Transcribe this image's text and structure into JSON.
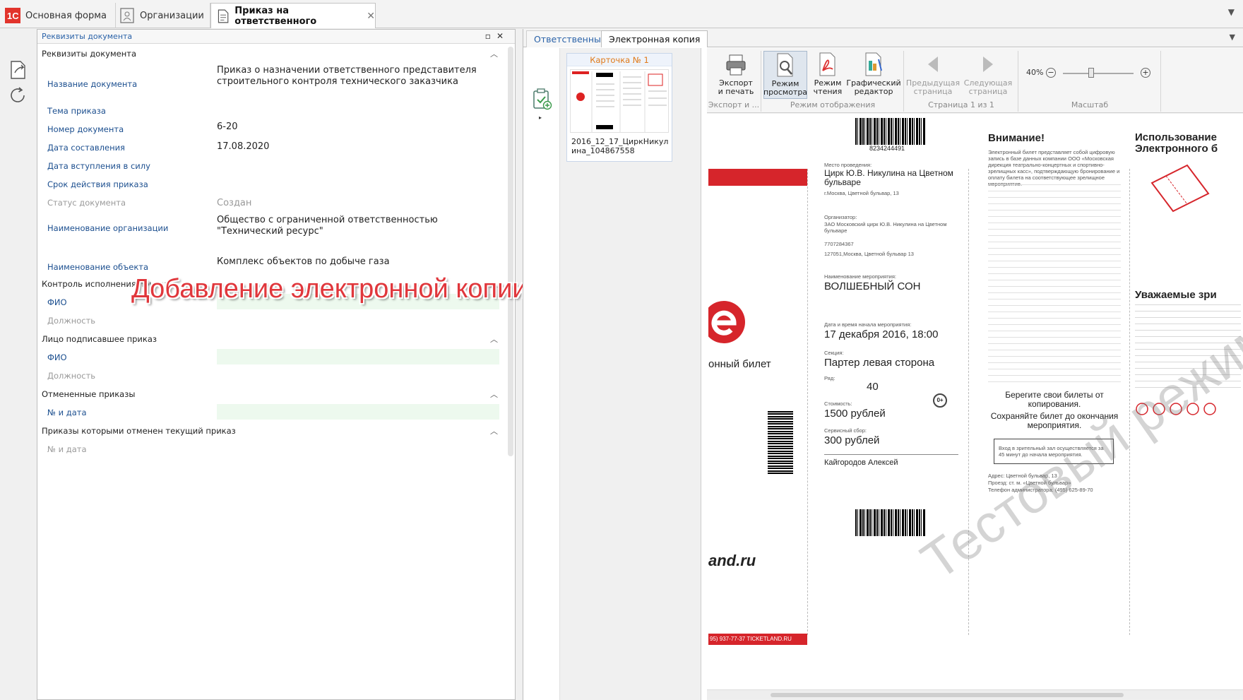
{
  "top_tabs": [
    {
      "label": "Основная форма"
    },
    {
      "label": "Организации"
    },
    {
      "label": "Приказ на ответственного"
    }
  ],
  "panel": {
    "title": "Реквизиты документа"
  },
  "sections": {
    "requisites": "Реквизиты документа",
    "control": "Контроль исполнения приказа",
    "signer": "Лицо подписавшее приказ",
    "cancelled": "Отмененные приказы",
    "cancelled_by": "Приказы которыми отменен текущий приказ"
  },
  "fields": {
    "doc_name_label": "Название документа",
    "doc_name_value": "Приказ о назначении ответственного представителя строительного контроля технического заказчика",
    "topic_label": "Тема приказа",
    "number_label": "Номер документа",
    "number_value": "6-20",
    "date_label": "Дата составления",
    "date_value": "17.08.2020",
    "effective_label": "Дата вступления в силу",
    "validity_label": "Срок действия приказа",
    "status_label": "Статус документа",
    "status_value": "Создан",
    "org_label": "Наименование организации",
    "org_value": "Общество с ограниченной ответственностью \"Технический ресурс\"",
    "object_label": "Наименование объекта",
    "object_value": "Комплекс объектов по добыче газа",
    "control_fio_label": "ФИО",
    "control_position_label": "Должность",
    "signer_fio_label": "ФИО",
    "signer_position_label": "Должность",
    "cancelled_num_label": "№ и дата",
    "cancelled_by_num_label": "№ и дата"
  },
  "overlay_caption": "Добавление электронной копии приказа",
  "right_tabs": [
    {
      "label": "Ответственные"
    },
    {
      "label": "Электронная копия"
    }
  ],
  "card": {
    "title": "Карточка № 1",
    "filename": "2016_12_17_ЦиркНикулина_104867558"
  },
  "ribbon": {
    "export_print": "Экспорт\nи печать",
    "view_mode": "Режим\nпросмотра",
    "read_mode": "Режим\nчтения",
    "graphic_editor": "Графический\nредактор",
    "prev_page": "Предыдущая\nстраница",
    "next_page": "Следующая\nстраница",
    "group_export": "Экспорт и ...",
    "group_display": "Режим отображения",
    "group_page": "Страница 1 из 1",
    "group_zoom": "Масштаб",
    "zoom_value": "40%"
  },
  "ticket": {
    "barcode_top": "8234244491",
    "venue_label": "Место проведения:",
    "venue": "Цирк Ю.В. Никулина на Цветном бульваре",
    "venue_addr": "г.Москва, Цветной бульвар, 13",
    "org_label": "Организатор:",
    "org": "ЗАО Московский цирк Ю.В. Никулина на Цветном бульваре",
    "inn": "7707284367",
    "org_addr": "127051,Москва, Цветной бульвар 13",
    "event_label": "Наименование мероприятия:",
    "event": "ВОЛШЕБНЫЙ СОН",
    "datetime_label": "Дата и время начала мероприятия:",
    "datetime": "17 декабря 2016, 18:00",
    "section_label": "Секция:",
    "section": "Партер левая сторона",
    "row_label": "Ряд:",
    "row_value": "40",
    "price_label": "Стоимость:",
    "price": "1500 рублей",
    "fee_label": "Сервисный сбор:",
    "fee": "300 рублей",
    "owner": "Кайгородов Алексей",
    "etix": "онный билет",
    "site": "and.ru",
    "phone_strip": "95) 937-77-37   TICKETLAND.RU",
    "attention": "Внимание!",
    "attention_text": "Электронный билет представляет собой цифровую запись в базе данных компании ООО «Московская дирекция театрально-концертных и спортивно-зрелищных касс», подтверждающую бронирование и оплату билета на соответствующее зрелищное мероприятие.",
    "keep_copy": "Берегите свои билеты от копирования.",
    "keep_until": "Сохраняйте билет до окончания мероприятия.",
    "entry_note": "Вход в зрительный зал осуществляется за 45 минут до начала мероприятия.",
    "address": "Адрес: Цветной бульвар, 13",
    "metro": "Проезд: ст. м. «Цветной бульвар»",
    "admin_phone": "Телефон администратора: (495) 625-89-70",
    "use_title": "Использование Электронного б",
    "dear": "Уважаемые зри",
    "age_badge": "0+",
    "watermark": "Тестовый режим"
  }
}
